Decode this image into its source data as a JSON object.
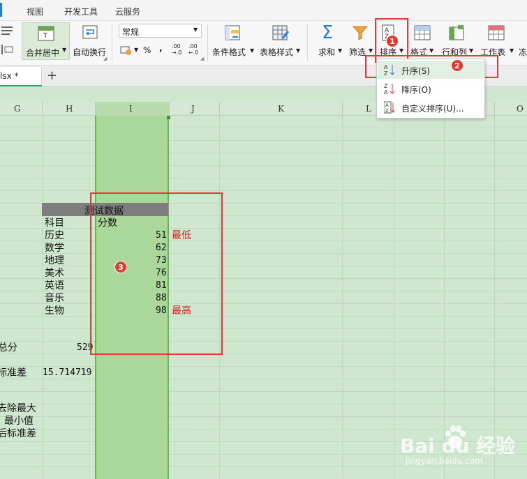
{
  "menu": {
    "items": [
      "视图",
      "开发工具",
      "云服务"
    ]
  },
  "ribbon": {
    "merge_label": "合并居中",
    "wrap_label": "自动换行",
    "format_select": "常规",
    "percent": "%",
    "comma": ",",
    "dec_inc": ".00 →.0",
    "dec_dec": ".00 ←.0",
    "cond_format": "条件格式",
    "table_style": "表格样式",
    "sum": "求和",
    "filter": "筛选",
    "sort": "排序",
    "format": "格式",
    "rows_cols": "行和列",
    "worksheet": "工作表",
    "freeze": "冻"
  },
  "tabs": {
    "file_tab": "lsx *",
    "add": "+"
  },
  "columns": [
    "G",
    "H",
    "I",
    "J",
    "K",
    "L",
    "O"
  ],
  "sort_menu": {
    "asc": "升序(S)",
    "desc": "降序(O)",
    "custom": "自定义排序(U)..."
  },
  "sheet": {
    "table_title": "测试数据",
    "subject_header": "科目",
    "score_header": "分数",
    "rows": [
      {
        "subject": "历史",
        "score": "51",
        "note": "最低"
      },
      {
        "subject": "数学",
        "score": "62",
        "note": ""
      },
      {
        "subject": "地理",
        "score": "73",
        "note": ""
      },
      {
        "subject": "美术",
        "score": "76",
        "note": ""
      },
      {
        "subject": "英语",
        "score": "81",
        "note": ""
      },
      {
        "subject": "音乐",
        "score": "88",
        "note": ""
      },
      {
        "subject": "生物",
        "score": "98",
        "note": "最高"
      }
    ],
    "total_label": "总分",
    "total_value": "529",
    "stdev_label": "标准差",
    "stdev_value": "15.714719",
    "trim_label_1": "去除最大",
    "trim_label_2": "最小值",
    "trim_label_3": "后标准差"
  },
  "badges": {
    "b1": "1",
    "b2": "2",
    "b3": "3"
  },
  "watermark": {
    "brand": "Bai du 经验",
    "url": "jingyan.baidu.com"
  }
}
